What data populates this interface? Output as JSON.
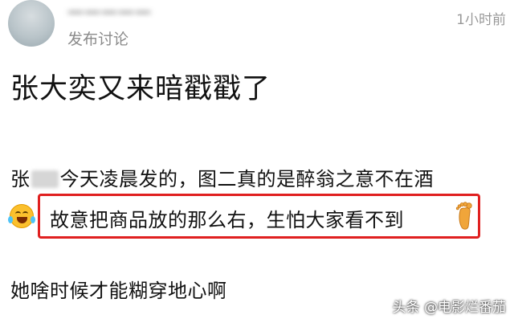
{
  "post": {
    "author": "一一一一一",
    "action": "发布讨论",
    "time": "1小时前",
    "title": "张大奕又来暗戳戳了",
    "line1_a": "张",
    "line1_b": "今天凌晨发的，图二真的是醉翁之意不在酒",
    "highlight": "故意把商品放的那么右，生怕大家看不到",
    "line3": "她啥时候才能糊穿地心啊"
  },
  "icons": {
    "laugh": "laughing-tears-icon",
    "foot": "foot-icon"
  },
  "watermark": "头条 @电影烂番茄",
  "colors": {
    "highlight_border": "#e02020",
    "meta_gray": "#8a8a8a"
  }
}
